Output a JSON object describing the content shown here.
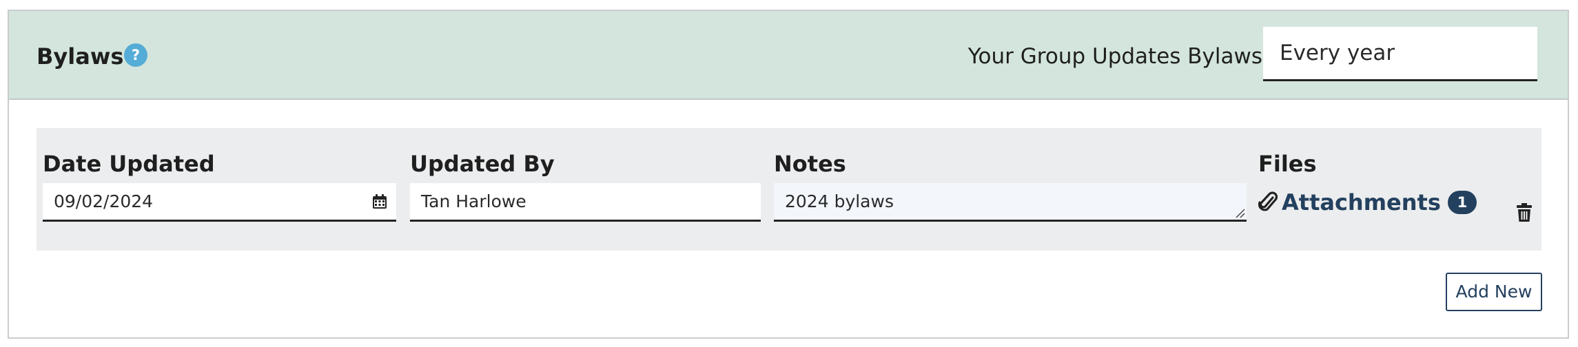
{
  "section": {
    "title": "Bylaws",
    "help_icon": "question-circle-icon",
    "help_glyph": "?",
    "frequency_label": "Your Group Updates Bylaws",
    "frequency_value": "Every year"
  },
  "table": {
    "columns": [
      "Date Updated",
      "Updated By",
      "Notes",
      "Files"
    ],
    "rows": [
      {
        "date_updated": "09/02/2024",
        "updated_by": "Tan Harlowe",
        "notes": "2024 bylaws",
        "files_label": "Attachments",
        "files_count": "1"
      }
    ]
  },
  "actions": {
    "add_new_label": "Add New"
  },
  "icons": {
    "calendar": "calendar-icon",
    "paperclip": "paperclip-icon",
    "delete": "trash-icon",
    "resize": "resize-handle-icon"
  },
  "colors": {
    "header_bg": "#d3e5dc",
    "help_accent": "#55acd6",
    "link_navy": "#23405f",
    "row_bg": "#ecedee"
  }
}
